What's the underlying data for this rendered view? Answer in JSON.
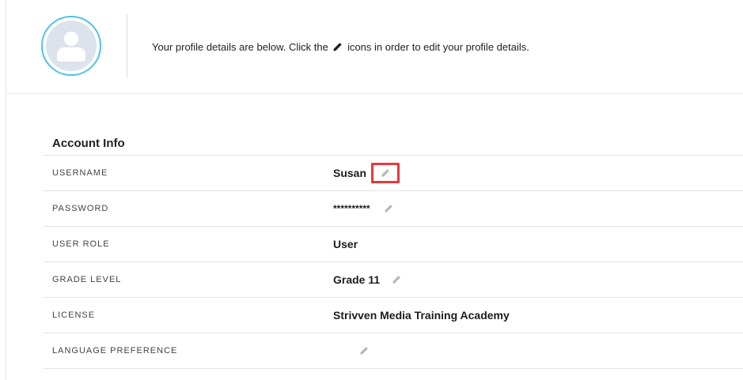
{
  "header": {
    "intro_before": "Your profile details are below. Click the",
    "intro_after": "icons in order to edit your profile details.",
    "avatar_icon": "user-silhouette-icon",
    "avatar_ring_color": "#4fc3e8"
  },
  "account": {
    "title": "Account Info",
    "rows": [
      {
        "label": "USERNAME",
        "value": "Susan",
        "editable": true,
        "highlighted": true
      },
      {
        "label": "PASSWORD",
        "value": "**********",
        "editable": true
      },
      {
        "label": "USER ROLE",
        "value": "User",
        "editable": false
      },
      {
        "label": "GRADE LEVEL",
        "value": "Grade 11",
        "editable": true
      },
      {
        "label": "LICENSE",
        "value": "Strivven Media Training Academy",
        "editable": false
      },
      {
        "label": "LANGUAGE PREFERENCE",
        "value": "",
        "editable": true
      }
    ]
  },
  "colors": {
    "highlight_border": "#e8383d",
    "edit_icon": "#b5b5b5"
  }
}
